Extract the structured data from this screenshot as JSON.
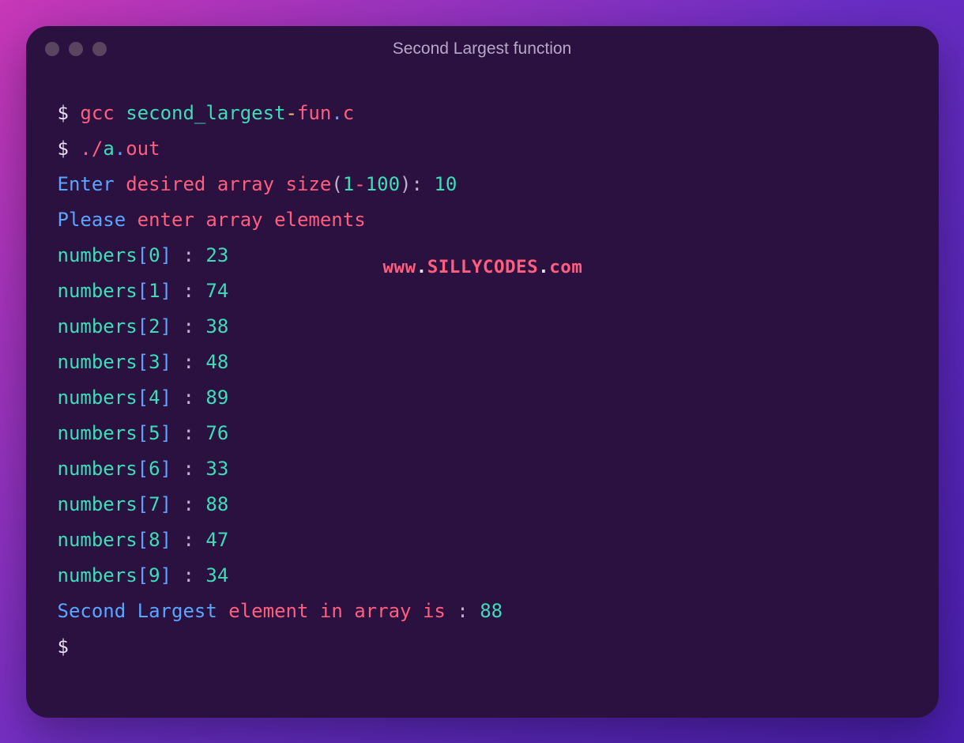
{
  "window": {
    "title": "Second Largest function"
  },
  "watermark": {
    "prefix": "www",
    "dot1": ".",
    "mid": "SILLYCODES",
    "dot2": ".",
    "suffix": "com"
  },
  "terminal": {
    "prompt": "$",
    "cmd1": {
      "p1": "gcc",
      "p2": "second_largest",
      "dash": "-",
      "p3": "fun",
      "dot": ".",
      "p4": "c"
    },
    "cmd2": {
      "p1": ".",
      "p2": "/",
      "p3": "a",
      "dot": ".",
      "p4": "out"
    },
    "enter": {
      "w1": "Enter",
      "w2": "desired",
      "w3": "array",
      "w4": "size",
      "lp": "(",
      "r1": "1",
      "dash": "-",
      "r2": "100",
      "rp": ")",
      "colon": ":",
      "val": "10"
    },
    "please": {
      "w1": "Please",
      "w2": "enter",
      "w3": "array",
      "w4": "elements"
    },
    "numbers_label": "numbers",
    "left_bracket": "[",
    "right_bracket": "]",
    "sep": " : ",
    "entries": [
      {
        "idx": "0",
        "val": "23"
      },
      {
        "idx": "1",
        "val": "74"
      },
      {
        "idx": "2",
        "val": "38"
      },
      {
        "idx": "3",
        "val": "48"
      },
      {
        "idx": "4",
        "val": "89"
      },
      {
        "idx": "5",
        "val": "76"
      },
      {
        "idx": "6",
        "val": "33"
      },
      {
        "idx": "7",
        "val": "88"
      },
      {
        "idx": "8",
        "val": "47"
      },
      {
        "idx": "9",
        "val": "34"
      }
    ],
    "result": {
      "w1": "Second",
      "w2": "Largest",
      "w3": "element",
      "w4": "in",
      "w5": "array",
      "w6": "is",
      "colon": ":",
      "val": "88"
    }
  }
}
